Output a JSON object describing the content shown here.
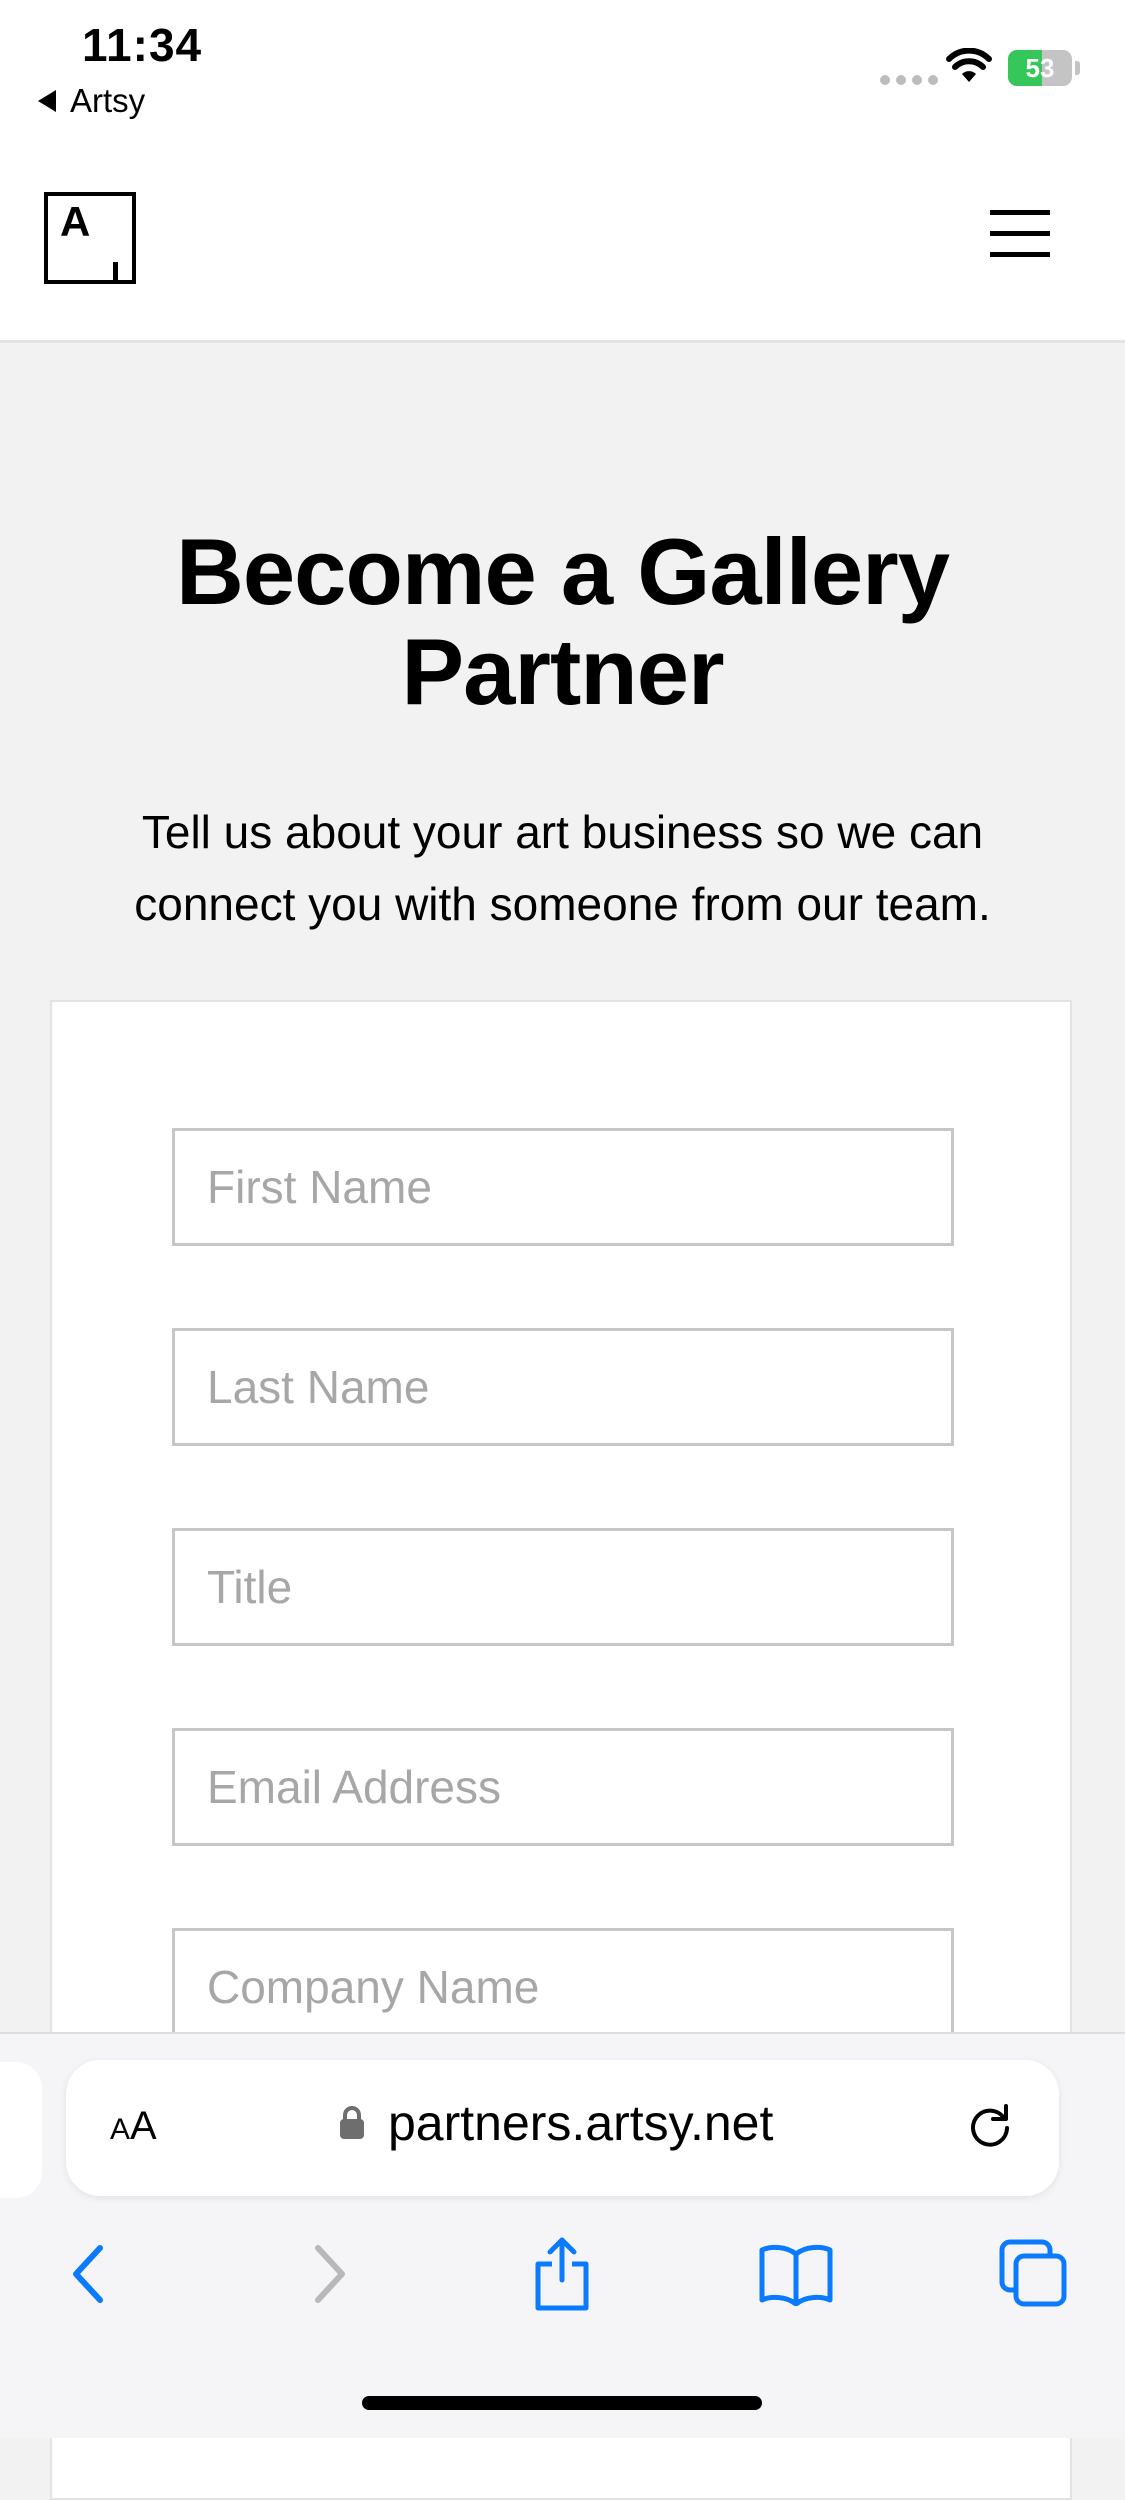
{
  "status_bar": {
    "time": "11:34",
    "back_app": "Artsy",
    "battery_percent": "53",
    "battery_level": 0.53,
    "battery_color": "#35c759"
  },
  "header": {
    "logo_letter": "A",
    "menu_icon": "hamburger-icon"
  },
  "main": {
    "heading": "Become a Gallery Partner",
    "subheading": "Tell us about your art business so we can connect you with someone from our team."
  },
  "form": {
    "fields": [
      {
        "placeholder": "First Name",
        "value": ""
      },
      {
        "placeholder": "Last Name",
        "value": ""
      },
      {
        "placeholder": "Title",
        "value": ""
      },
      {
        "placeholder": "Email Address",
        "value": ""
      },
      {
        "placeholder": "Company Name",
        "value": ""
      }
    ]
  },
  "browser": {
    "aa_label_small": "A",
    "aa_label_large": "A",
    "url": "partners.artsy.net",
    "accent_color": "#0a7aff",
    "toolbar_icons": [
      "back-arrow-icon",
      "forward-arrow-icon",
      "share-icon",
      "bookmarks-icon",
      "tabs-icon"
    ]
  }
}
